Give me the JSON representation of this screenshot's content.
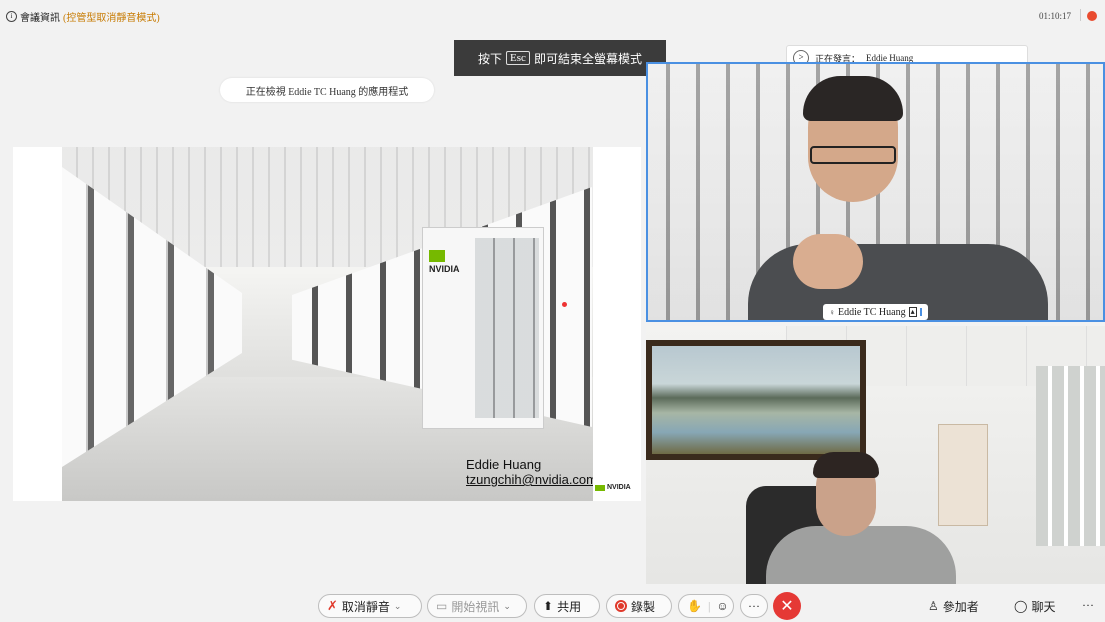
{
  "topbar": {
    "meeting_info_label": "會議資訊",
    "meeting_mode": "(控管型取消靜音模式)",
    "timer": "01:10:17"
  },
  "banner": {
    "prefix": "按下",
    "key": "Esc",
    "suffix": "即可結束全螢幕模式"
  },
  "share": {
    "viewing_text": "正在檢視 Eddie TC Huang 的應用程式",
    "slide_name": "Eddie Huang",
    "slide_email": "tzungchih@nvidia.com",
    "nvidia_wordmark": "NVIDIA",
    "cabinet_wordmark": "NVIDIA"
  },
  "speaking": {
    "label": "正在發言：",
    "name": "Eddie Huang"
  },
  "tiles": [
    {
      "name": "Eddie TC Huang",
      "active": true
    }
  ],
  "toolbar": {
    "unmute": "取消靜音",
    "start_video": "開始視訊",
    "share": "共用",
    "record": "錄製",
    "participants": "參加者",
    "chat": "聊天",
    "more": "···"
  },
  "colors": {
    "accent": "#4a90e2",
    "danger": "#e53935",
    "mode_text": "#c77a00",
    "nvidia_green": "#76b900"
  },
  "icons": [
    "info-icon",
    "record-dot-icon",
    "mic-off-icon",
    "video-off-icon",
    "share-icon",
    "record-icon",
    "hand-icon",
    "emoji-icon",
    "more-icon",
    "end-call-icon",
    "participants-icon",
    "chat-icon",
    "chevron-right-icon"
  ]
}
